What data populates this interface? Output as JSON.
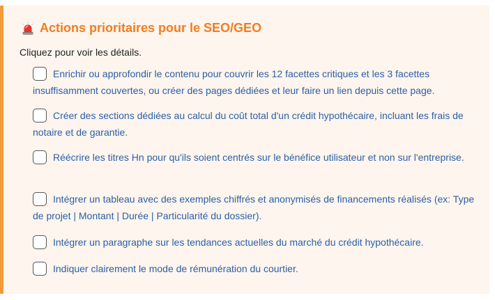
{
  "panel": {
    "title": "Actions prioritaires pour le SEO/GEO",
    "title_icon": "siren-icon",
    "subtitle": "Cliquez pour voir les détails.",
    "accent_color": "#f07d1e",
    "border_color": "#f39a3c",
    "link_color": "#2b5fa6"
  },
  "actions": [
    {
      "label": "Enrichir ou approfondir le contenu pour couvrir les 12 facettes critiques et les 3 facettes insuffisamment couvertes, ou créer des pages dédiées et leur faire un lien depuis cette page.",
      "checked": false
    },
    {
      "label": "Créer des sections dédiées au calcul du coût total d'un crédit hypothécaire, incluant les frais de notaire et de garantie.",
      "checked": false
    },
    {
      "label": "Réécrire les titres Hn pour qu'ils soient centrés sur le bénéfice utilisateur et non sur l'entreprise.",
      "checked": false
    },
    {
      "label": "Intégrer un tableau avec des exemples chiffrés et anonymisés de financements réalisés (ex: Type de projet | Montant | Durée | Particularité du dossier).",
      "checked": false
    },
    {
      "label": "Intégrer un paragraphe sur les tendances actuelles du marché du crédit hypothécaire.",
      "checked": false
    },
    {
      "label": "Indiquer clairement le mode de rémunération du courtier.",
      "checked": false
    }
  ]
}
